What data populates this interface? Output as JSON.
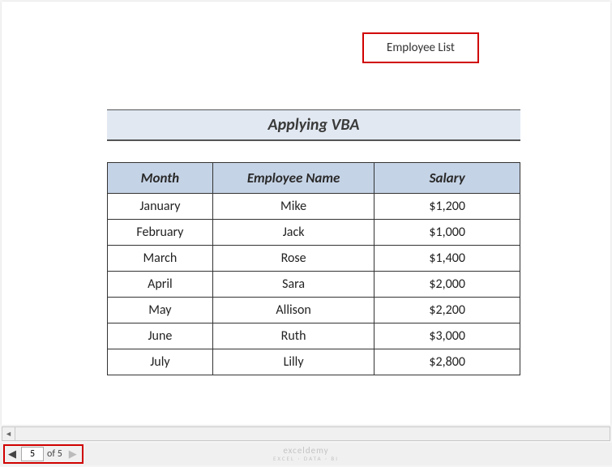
{
  "header": {
    "text": "Employee List"
  },
  "title": "Applying VBA",
  "table": {
    "headers": [
      "Month",
      "Employee Name",
      "Salary"
    ],
    "rows": [
      {
        "month": "January",
        "name": "Mike",
        "salary": "$1,200"
      },
      {
        "month": "February",
        "name": "Jack",
        "salary": "$1,000"
      },
      {
        "month": "March",
        "name": "Rose",
        "salary": "$1,400"
      },
      {
        "month": "April",
        "name": "Sara",
        "salary": "$2,000"
      },
      {
        "month": "May",
        "name": "Allison",
        "salary": "$2,200"
      },
      {
        "month": "June",
        "name": "Ruth",
        "salary": "$3,000"
      },
      {
        "month": "July",
        "name": "Lilly",
        "salary": "$2,800"
      }
    ]
  },
  "pagination": {
    "current": "5",
    "of_label": "of 5"
  },
  "watermark": {
    "main": "exceldemy",
    "sub": "EXCEL · DATA · BI"
  }
}
